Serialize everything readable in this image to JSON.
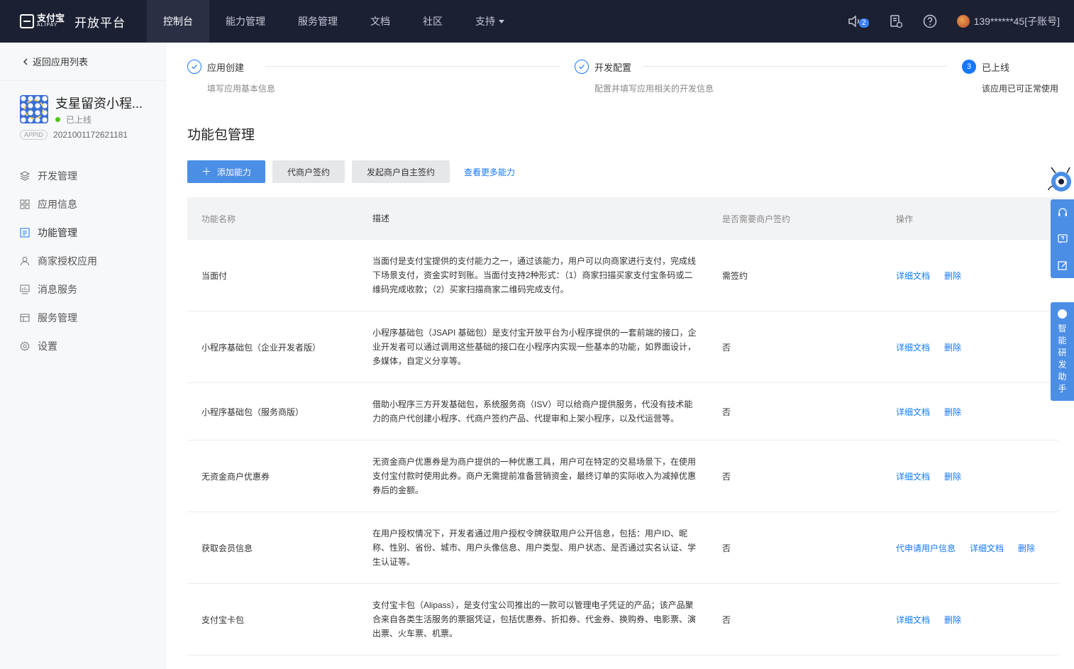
{
  "brand": {
    "cn": "支付宝",
    "en": "ALIPAY",
    "platform": "开放平台"
  },
  "nav": {
    "items": [
      {
        "label": "控制台",
        "active": true
      },
      {
        "label": "能力管理"
      },
      {
        "label": "服务管理"
      },
      {
        "label": "文档"
      },
      {
        "label": "社区"
      },
      {
        "label": "支持"
      }
    ],
    "notification_count": "2",
    "account": "139******45[子账号]"
  },
  "sidebar": {
    "back_label": "返回应用列表",
    "app_name": "支星留资小程...",
    "app_status": "已上线",
    "appid_tag": "APPID",
    "appid": "2021001172621181",
    "menu": [
      {
        "label": "开发管理",
        "icon": "layers-icon"
      },
      {
        "label": "应用信息",
        "icon": "grid-icon"
      },
      {
        "label": "功能管理",
        "icon": "document-list-icon",
        "active": true
      },
      {
        "label": "商家授权应用",
        "icon": "user-icon"
      },
      {
        "label": "消息服务",
        "icon": "chart-icon"
      },
      {
        "label": "服务管理",
        "icon": "table-icon"
      },
      {
        "label": "设置",
        "icon": "gear-icon"
      }
    ]
  },
  "steps": [
    {
      "title": "应用创建",
      "desc": "填写应用基本信息",
      "state": "done"
    },
    {
      "title": "开发配置",
      "desc": "配置并填写应用相关的开发信息",
      "state": "done"
    },
    {
      "number": "3",
      "title": "已上线",
      "desc": "该应用已可正常使用",
      "state": "current"
    }
  ],
  "page_title": "功能包管理",
  "actions": {
    "add": "添加能力",
    "agent_sign": "代商户签约",
    "merchant_sign": "发起商户自主签约",
    "more": "查看更多能力"
  },
  "table": {
    "headers": [
      "功能名称",
      "描述",
      "是否需要商户签约",
      "操作"
    ],
    "rows": [
      {
        "name": "当面付",
        "desc": "当面付是支付宝提供的支付能力之一，通过该能力，用户可以向商家进行支付，完成线下场景支付，资金实时到账。当面付支持2种形式：（1）商家扫描买家支付宝条码或二维码完成收款；（2）买家扫描商家二维码完成支付。",
        "sign": "需签约",
        "ops": [
          "详细文档",
          "删除"
        ]
      },
      {
        "name": "小程序基础包（企业开发者版）",
        "desc": "小程序基础包（JSAPI 基础包）是支付宝开放平台为小程序提供的一套前端的接口，企业开发者可以通过调用这些基础的接口在小程序内实现一些基本的功能，如界面设计，多媒体，自定义分享等。",
        "sign": "否",
        "ops": [
          "详细文档",
          "删除"
        ]
      },
      {
        "name": "小程序基础包（服务商版）",
        "desc": "借助小程序三方开发基础包，系统服务商（ISV）可以给商户提供服务，代没有技术能力的商户代创建小程序、代商户签约产品、代提审和上架小程序，以及代运营等。",
        "sign": "否",
        "ops": [
          "详细文档",
          "删除"
        ]
      },
      {
        "name": "无资金商户优惠券",
        "desc": "无资金商户优惠券是为商户提供的一种优惠工具，用户可在特定的交易场景下，在使用支付宝付款时使用此券。商户无需提前准备营销资金，最终订单的实际收入为减掉优惠券后的金额。",
        "sign": "否",
        "ops": [
          "详细文档",
          "删除"
        ]
      },
      {
        "name": "获取会员信息",
        "desc": "在用户授权情况下，开发者通过用户授权令牌获取用户公开信息，包括：用户ID、昵称、性别、省份、城市、用户头像信息、用户类型、用户状态、是否通过实名认证、学生认证等。",
        "sign": "否",
        "ops": [
          "代申请用户信息",
          "详细文档",
          "删除"
        ]
      },
      {
        "name": "支付宝卡包",
        "desc": "支付宝卡包（Alipass），是支付宝公司推出的一款可以管理电子凭证的产品；该产品聚合来自各类生活服务的票据凭证，包括优惠券、折扣券、代金券、换购券、电影票、演出票、火车票、机票。",
        "sign": "否",
        "ops": [
          "详细文档",
          "删除"
        ]
      }
    ]
  },
  "assistant": {
    "label": "智能研发助手"
  },
  "colors": {
    "nav_bg": "#1c2033",
    "accent": "#1677ff",
    "float_blue": "#4a8ee6",
    "online": "#52c41a"
  }
}
